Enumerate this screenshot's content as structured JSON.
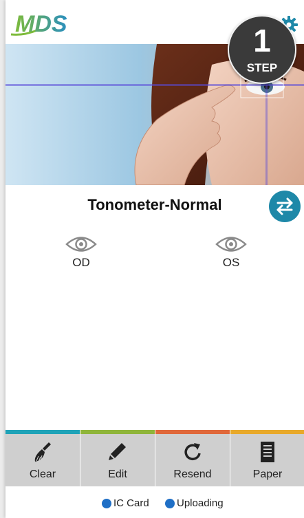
{
  "header": {
    "logo_text": "MDS",
    "settings_icon": "gear-icon"
  },
  "banner": {
    "step_number": "1",
    "step_label": "STEP"
  },
  "exam": {
    "title": "Tonometer-Normal",
    "swap_icon": "swap-arrows-icon",
    "left_eye_label": "OD",
    "right_eye_label": "OS",
    "eye_icon": "eye-icon"
  },
  "toolbar": {
    "buttons": [
      {
        "label": "Clear",
        "icon": "broom-icon",
        "color": "#1fa3b8"
      },
      {
        "label": "Edit",
        "icon": "pencil-icon",
        "color": "#8fb53a"
      },
      {
        "label": "Resend",
        "icon": "refresh-icon",
        "color": "#e0683a"
      },
      {
        "label": "Paper",
        "icon": "document-icon",
        "color": "#e8a92a"
      }
    ]
  },
  "status": {
    "ic_card": "IC Card",
    "uploading": "Uploading",
    "dot_color": "#1f6fc6"
  },
  "colors": {
    "accent": "#1e88a8"
  }
}
